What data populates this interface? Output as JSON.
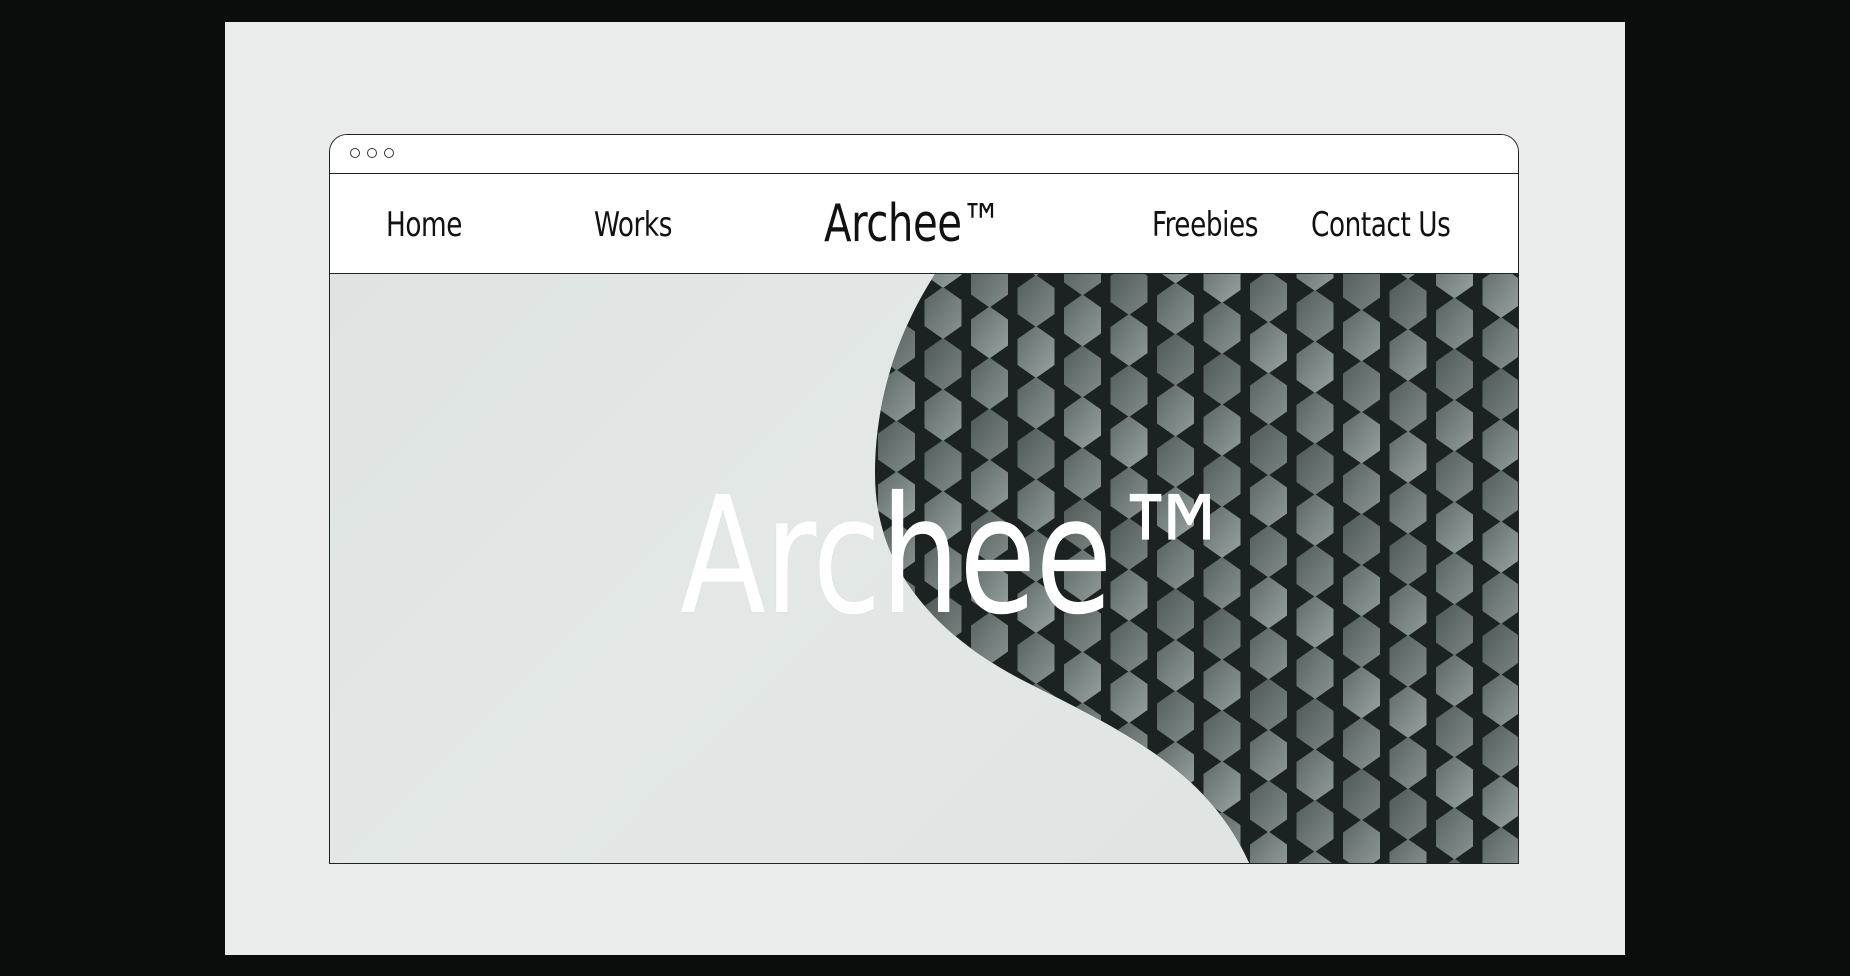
{
  "browser": {
    "window_controls": [
      "circle-icon",
      "circle-icon",
      "circle-icon"
    ]
  },
  "nav": {
    "home": "Home",
    "works": "Works",
    "brand": "Archee™",
    "freebies": "Freebies",
    "contact": "Contact Us"
  },
  "hero": {
    "title": "Archee™",
    "image": "hexagon-facade-photo"
  },
  "colors": {
    "background": "#0b0c0c",
    "canvas": "#e9ecea",
    "hero_sky": "#dfe4e2",
    "facade_tile": "#7a8584",
    "facade_grout": "#1b2020"
  }
}
